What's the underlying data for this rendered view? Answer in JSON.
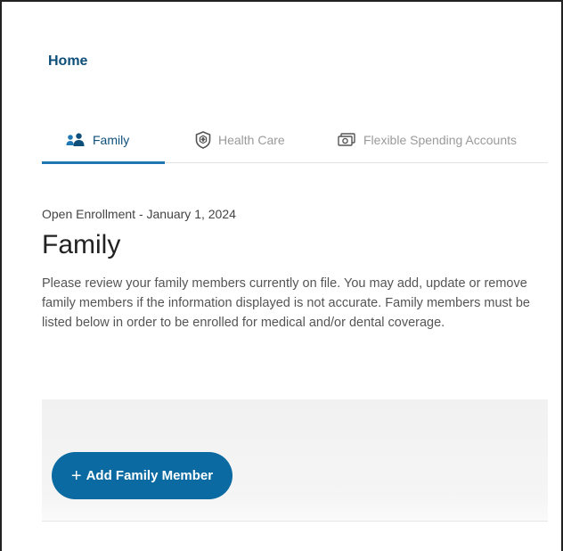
{
  "breadcrumb": {
    "home_label": "Home"
  },
  "tabs": [
    {
      "label": "Family",
      "icon": "family-icon",
      "active": true
    },
    {
      "label": "Health Care",
      "icon": "shield-cross-icon",
      "active": false
    },
    {
      "label": "Flexible Spending Accounts",
      "icon": "money-icon",
      "active": false
    }
  ],
  "main": {
    "enrollment_label": "Open Enrollment - January 1, 2024",
    "title": "Family",
    "description": "Please review your family members currently on file. You may add, update or remove family members if the information displayed is not accurate. Family members must be listed below in order to be enrolled for medical and/or dental coverage."
  },
  "actions": {
    "add_symbol": "+",
    "add_label": "Add Family Member"
  },
  "colors": {
    "brand": "#0a6aa1",
    "link": "#0e4f7a",
    "tab_underline": "#1f78b4",
    "inactive_tab": "#9a9a9a"
  }
}
